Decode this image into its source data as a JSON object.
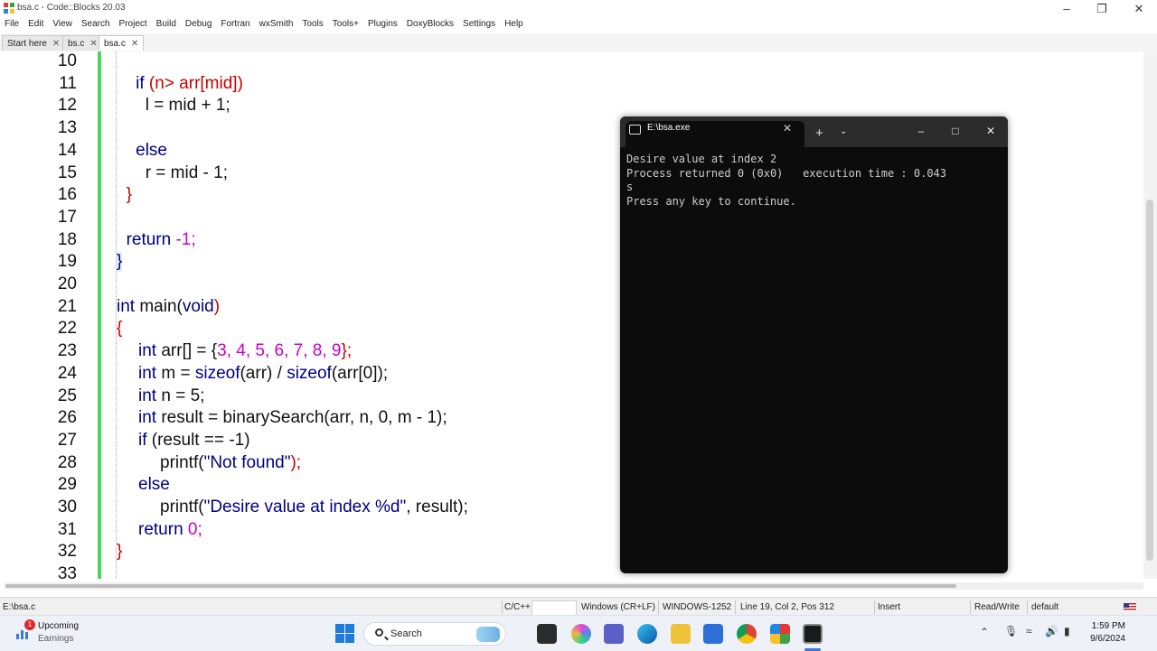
{
  "window": {
    "title": "bsa.c - Code::Blocks 20.03"
  },
  "menu": [
    "File",
    "Edit",
    "View",
    "Search",
    "Project",
    "Build",
    "Debug",
    "Fortran",
    "wxSmith",
    "Tools",
    "Tools+",
    "Plugins",
    "DoxyBlocks",
    "Settings",
    "Help"
  ],
  "tabs": [
    {
      "label": "Start here",
      "active": false
    },
    {
      "label": "bs.c",
      "active": false
    },
    {
      "label": "bsa.c",
      "active": true
    }
  ],
  "editor": {
    "line_numbers": [
      "10",
      "11",
      "12",
      "13",
      "14",
      "15",
      "16",
      "17",
      "18",
      "19",
      "20",
      "21",
      "22",
      "23",
      "24",
      "25",
      "26",
      "27",
      "28",
      "29",
      "30",
      "31",
      "32",
      "33"
    ],
    "code": {
      "l10": "",
      "l11": {
        "indent": "    ",
        "kw": "if",
        "rest": " (n> arr[mid])"
      },
      "l12": {
        "indent": "      ",
        "text": "l = mid + 1;"
      },
      "l14": {
        "indent": "    ",
        "kw": "else"
      },
      "l15": {
        "indent": "      ",
        "text": "r = mid - 1;"
      },
      "l16": {
        "indent": "  ",
        "text": "}"
      },
      "l18": {
        "indent": "  ",
        "kw": "return",
        "rest": " -1;"
      },
      "l19": "}",
      "l21": {
        "kw1": "int",
        "a": " main(",
        "kw2": "void",
        "b": ")"
      },
      "l22": "{",
      "l23": {
        "kw": "int",
        "a": " arr[] = {",
        "nums": "3, 4, 5, 6, 7, 8, 9",
        "b": "};"
      },
      "l24": {
        "kw": "int",
        "a": " m = ",
        "fn1": "sizeof",
        "b": "(arr) / ",
        "fn2": "sizeof",
        "c": "(arr[0]);"
      },
      "l25": {
        "kw": "int",
        "a": " n = 5;"
      },
      "l26": {
        "kw": "int",
        "a": " result = binarySearch(arr, n, 0, m - 1);"
      },
      "l27": {
        "kw": "if",
        "a": " (result == -1)"
      },
      "l28": {
        "a": "printf(",
        "str": "\"Not found\"",
        "b": ");"
      },
      "l29": {
        "kw": "else"
      },
      "l30": {
        "a": "printf(",
        "str": "\"Desire value at index %d\"",
        "b": ", result);"
      },
      "l31": {
        "kw": "return",
        "a": " 0;"
      },
      "l32": "}"
    }
  },
  "console": {
    "tab_title": "E:\\bsa.exe",
    "output": "Desire value at index 2\nProcess returned 0 (0x0)   execution time : 0.043\ns\nPress any key to continue."
  },
  "status": {
    "file": "E:\\bsa.c",
    "language": "C/C++",
    "eol": "Windows (CR+LF)",
    "encoding": "WINDOWS-1252",
    "position": "Line 19, Col 2, Pos 312",
    "mode": "Insert",
    "access": "Read/Write",
    "profile": "default"
  },
  "taskbar": {
    "weather_title": "Upcoming",
    "weather_sub": "Earnings",
    "badge": "1",
    "search": "Search",
    "time": "1:59 PM",
    "date": "9/6/2024"
  }
}
